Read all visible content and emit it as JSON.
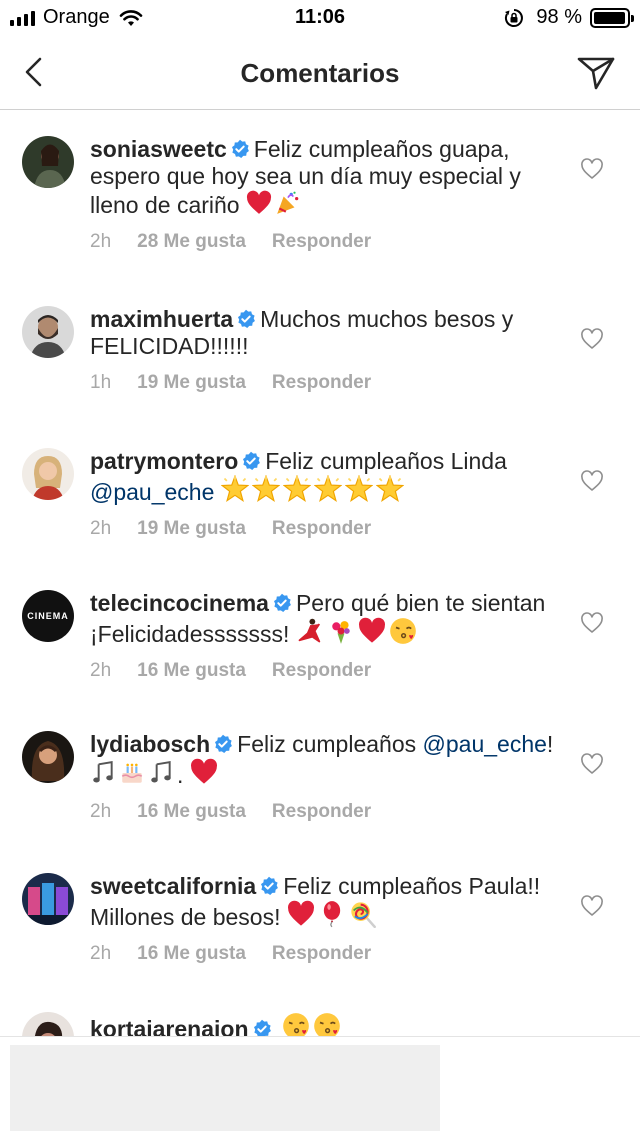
{
  "status_bar": {
    "carrier": "Orange",
    "time": "11:06",
    "battery_percent": "98 %",
    "battery_level": 0.98
  },
  "header": {
    "title": "Comentarios"
  },
  "comments": [
    {
      "username": "soniasweetc",
      "text": "Feliz cumpleaños guapa, espero que hoy sea un día muy especial y lleno de cariño",
      "emojis": [
        "red-heart",
        "party-popper"
      ],
      "age": "2h",
      "likes": "28 Me gusta",
      "reply": "Responder"
    },
    {
      "username": "maximhuerta",
      "text": "Muchos muchos besos y FELICIDAD!!!!!!",
      "emojis": [],
      "age": "1h",
      "likes": "19 Me gusta",
      "reply": "Responder"
    },
    {
      "username": "patrymontero",
      "text": "Feliz cumpleaños Linda",
      "mention": "@pau_eche",
      "emojis": [
        "glowing-star",
        "glowing-star",
        "glowing-star",
        "glowing-star",
        "glowing-star",
        "glowing-star"
      ],
      "age": "2h",
      "likes": "19 Me gusta",
      "reply": "Responder"
    },
    {
      "username": "telecincocinema",
      "avatar_text": "CINEMA",
      "text": "Pero qué bien te sientan ¡Felicidadesssssss!",
      "emojis": [
        "dancer",
        "bouquet",
        "red-heart",
        "kiss-face"
      ],
      "age": "2h",
      "likes": "16 Me gusta",
      "reply": "Responder"
    },
    {
      "username": "lydiabosch",
      "text": "Feliz cumpleaños",
      "mention": "@pau_eche",
      "text_after": "!",
      "emojis": [
        "music-notes",
        "birthday-cake",
        "music-notes"
      ],
      "text_tail": ".",
      "emojis_tail": [
        "red-heart"
      ],
      "age": "2h",
      "likes": "16 Me gusta",
      "reply": "Responder"
    },
    {
      "username": "sweetcalifornia",
      "text": "Feliz cumpleaños Paula!! Millones de besos!",
      "emojis": [
        "red-heart",
        "balloon",
        "lollipop"
      ],
      "age": "2h",
      "likes": "16 Me gusta",
      "reply": "Responder"
    },
    {
      "username": "kortajarenajon",
      "text": "",
      "emojis": [
        "kiss-face",
        "kiss-face"
      ]
    }
  ],
  "colors": {
    "verified_blue": "#3897f0",
    "meta_gray": "#a8a8a8",
    "mention_blue": "#003569",
    "text": "#262626",
    "heart_red": "#e0203a"
  }
}
